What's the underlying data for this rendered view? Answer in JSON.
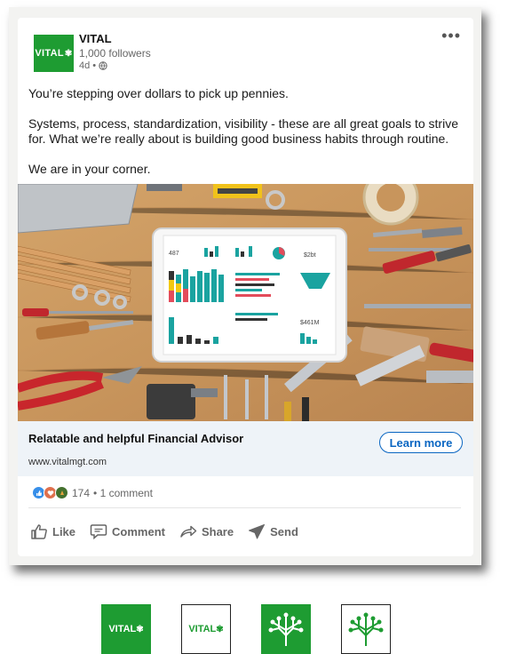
{
  "company": {
    "name": "VITAL",
    "followers": "1,000 followers",
    "time": "4d •",
    "logo_text": "VITAL"
  },
  "post": {
    "paragraphs": [
      "You’re stepping over dollars to pick up pennies.",
      "Systems, process, standardization, visibility - these are all great goals to strive for. What we’re really about is building good business habits through routine.",
      "We are in your corner."
    ]
  },
  "tablet": {
    "kpi1": "487",
    "kpi2": "$2bt",
    "kpi3": "$461M"
  },
  "link": {
    "title": "Relatable and helpful Financial Advisor",
    "url": "www.vitalmgt.com",
    "cta": "Learn more"
  },
  "social": {
    "count": "174",
    "comments": "• 1 comment"
  },
  "actions": {
    "like": "Like",
    "comment": "Comment",
    "share": "Share",
    "send": "Send"
  },
  "colors": {
    "brand": "#1e9c32",
    "link": "#0a66c2"
  }
}
